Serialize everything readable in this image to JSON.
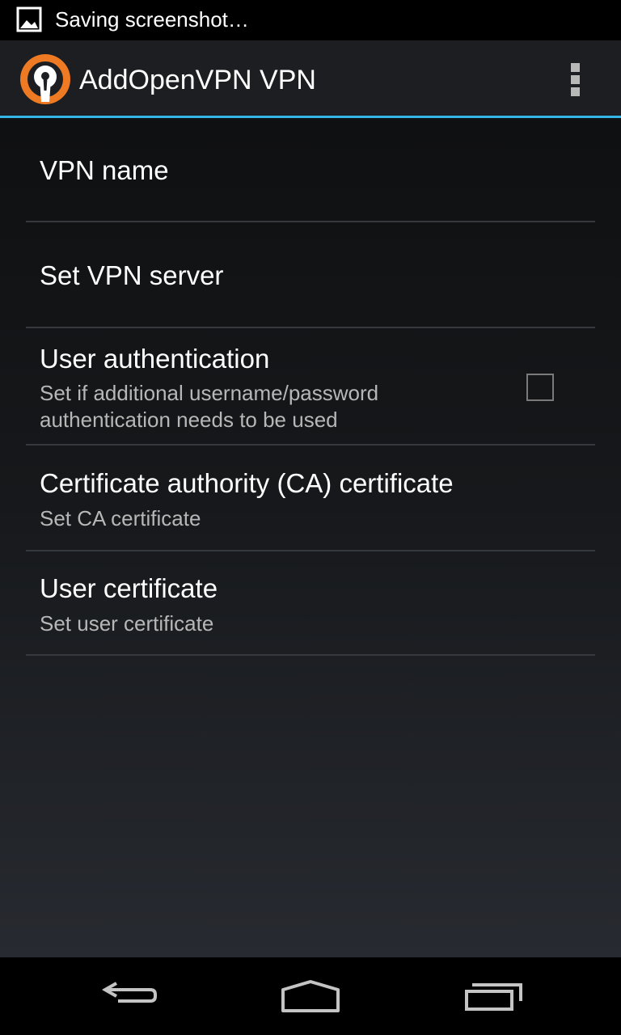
{
  "status_bar": {
    "notification_icon": "image-icon",
    "text": "Saving screenshot…"
  },
  "action_bar": {
    "logo_icon": "openvpn-logo",
    "title": "AddOpenVPN VPN",
    "overflow_icon": "overflow-menu-icon",
    "accent_color": "#33b5e5"
  },
  "preferences": [
    {
      "title": "VPN name"
    },
    {
      "title": "Set VPN server"
    },
    {
      "title": "User authentication",
      "summary_line1": "Set if additional username/password",
      "summary_line2": "authentication needs to be used",
      "checked": false
    },
    {
      "title": "Certificate authority (CA) certificate",
      "summary": "Set CA certificate"
    },
    {
      "title": "User certificate",
      "summary": "Set user certificate"
    }
  ],
  "nav_bar": {
    "back_icon": "back-icon",
    "home_icon": "home-icon",
    "recents_icon": "recent-apps-icon"
  }
}
